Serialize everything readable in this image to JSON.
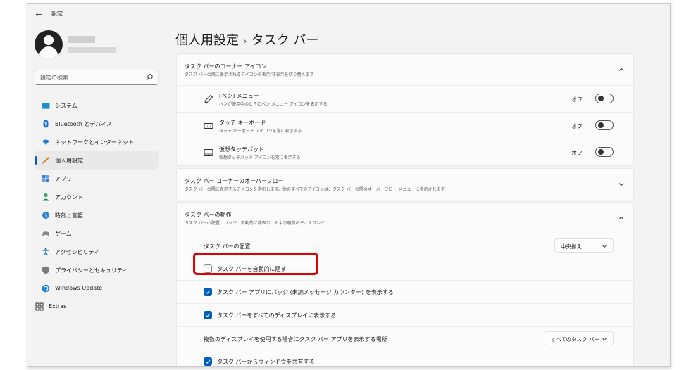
{
  "window": {
    "title": "設定",
    "back_icon": "back-arrow-icon"
  },
  "user": {
    "avatar_icon": "user-avatar-icon"
  },
  "search": {
    "placeholder": "設定の検索",
    "icon": "search-icon"
  },
  "sidebar": {
    "items": [
      {
        "label": "システム",
        "icon": "system-icon",
        "active": false
      },
      {
        "label": "Bluetooth とデバイス",
        "icon": "bluetooth-icon",
        "active": false
      },
      {
        "label": "ネットワークとインターネット",
        "icon": "network-icon",
        "active": false
      },
      {
        "label": "個人用設定",
        "icon": "personalization-icon",
        "active": true
      },
      {
        "label": "アプリ",
        "icon": "apps-icon",
        "active": false
      },
      {
        "label": "アカウント",
        "icon": "account-icon",
        "active": false
      },
      {
        "label": "時刻と言語",
        "icon": "time-language-icon",
        "active": false
      },
      {
        "label": "ゲーム",
        "icon": "gaming-icon",
        "active": false
      },
      {
        "label": "アクセシビリティ",
        "icon": "accessibility-icon",
        "active": false
      },
      {
        "label": "プライバシーとセキュリティ",
        "icon": "privacy-shield-icon",
        "active": false
      },
      {
        "label": "Windows Update",
        "icon": "windows-update-icon",
        "active": false
      },
      {
        "label": "Extras",
        "icon": "extras-icon",
        "active": false
      }
    ]
  },
  "page": {
    "breadcrumb_parent": "個人用設定",
    "separator": "›",
    "breadcrumb_current": "タスク バー"
  },
  "corner_icons": {
    "title": "タスク バーのコーナー アイコン",
    "subtitle": "タスク バーの隅に表示されるアイコンの表示/非表示を切り替えます",
    "rows": [
      {
        "title": "[ペン] メニュー",
        "subtitle": "ペンが使用中のときにペン メニュー アイコンを表示する",
        "state": "オフ",
        "icon": "pen-icon"
      },
      {
        "title": "タッチ キーボード",
        "subtitle": "タッチ キーボード アイコンを常に表示する",
        "state": "オフ",
        "icon": "keyboard-icon"
      },
      {
        "title": "仮想タッチパッド",
        "subtitle": "仮想タッチパッド アイコンを常に表示する",
        "state": "オフ",
        "icon": "touchpad-icon"
      }
    ]
  },
  "overflow": {
    "title": "タスク バー コーナーのオーバーフロー",
    "subtitle": "タスク バーの隅に表示するアイコンを選択します。他のすべてのアイコンは、タスク バーの隅のオーバーフロー メニューに表示されます"
  },
  "behaviors": {
    "title": "タスク バーの動作",
    "subtitle": "タスク バーの配置、バッジ、自動的に非表示、および複数のディスプレイ",
    "alignment_label": "タスク バーの配置",
    "alignment_value": "中央揃え",
    "autohide_label": "タスク バーを自動的に隠す",
    "autohide_checked": false,
    "badges_label": "タスク バー アプリにバッジ (未読メッセージ カウンター) を表示する",
    "badges_checked": true,
    "all_displays_label": "タスク バーをすべてのディスプレイに表示する",
    "all_displays_checked": true,
    "multi_display_label": "複数のディスプレイを使用する場合にタスク バー アプリを表示する場所",
    "multi_display_value": "すべてのタスク バー",
    "share_label": "タスク バーからウィンドウを共有する",
    "share_checked": true
  },
  "colors": {
    "accent": "#005fb8",
    "highlight": "#e00000",
    "background": "#f3f3f3",
    "card": "#fbfbfb"
  }
}
